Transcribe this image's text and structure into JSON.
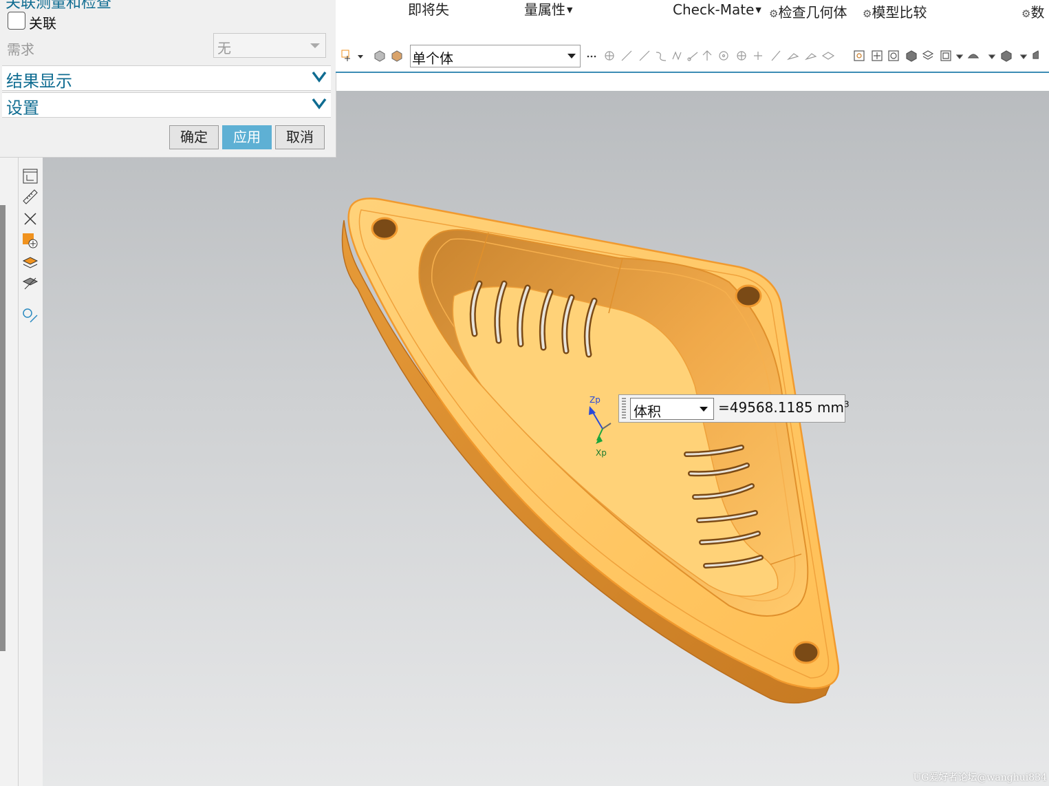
{
  "ribbon": {
    "item1": "即将失",
    "item2": "量属性",
    "checkmate": "Check-Mate",
    "check_geometry": "检查几何体",
    "model_compare": "模型比较",
    "data": "数"
  },
  "toolbar": {
    "selection_filter": "单个体"
  },
  "dialog": {
    "title": "关联测量和检查",
    "associative_label": "关联",
    "requirement_label": "需求",
    "requirement_value": "无",
    "sections": [
      "结果显示",
      "设置"
    ],
    "ok_label": "确定",
    "apply_label": "应用",
    "cancel_label": "取消"
  },
  "measurement": {
    "type": "体积",
    "value": "=49568.1185 mm",
    "unit_exponent": "3"
  },
  "axes": {
    "z": "Zp",
    "x": "Xp"
  },
  "watermark": "UG爱好者论坛@wanghui834",
  "colors": {
    "part": "#ffc65e",
    "accent": "#0f6c91",
    "apply_button": "#5eb0d4"
  }
}
